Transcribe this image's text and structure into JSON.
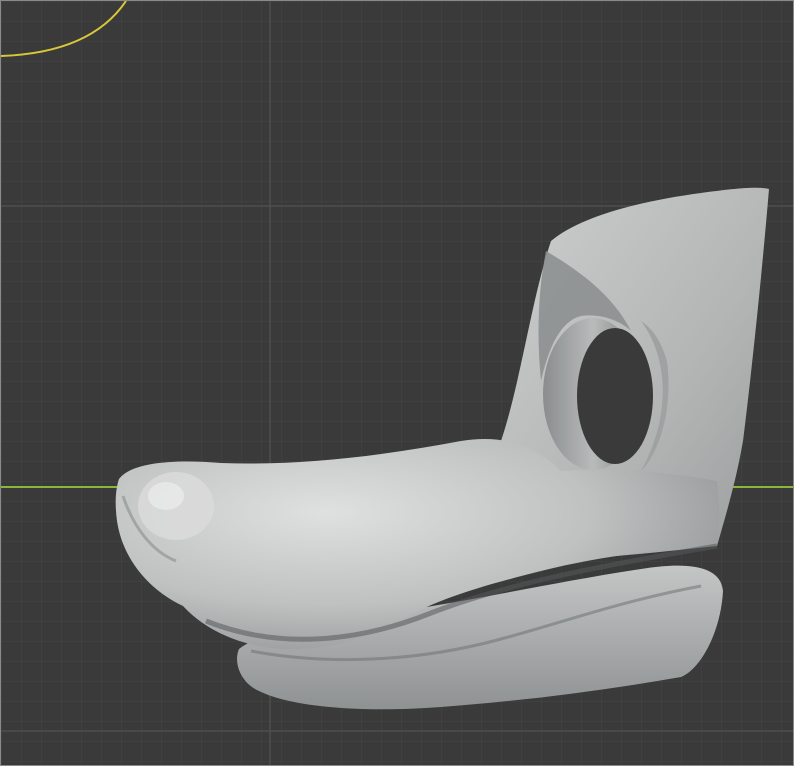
{
  "viewport": {
    "colors": {
      "background": "#3a3a3a",
      "grid_minor": "#444444",
      "grid_major": "#4d4d4d",
      "x_axis": "#8ab73a",
      "light_circle": "#d8c838",
      "model_base": "#b5b7b7",
      "model_shadow": "#7e8182",
      "model_highlight": "#e2e3e3"
    },
    "icons": [
      "light-gizmo-icon"
    ]
  }
}
